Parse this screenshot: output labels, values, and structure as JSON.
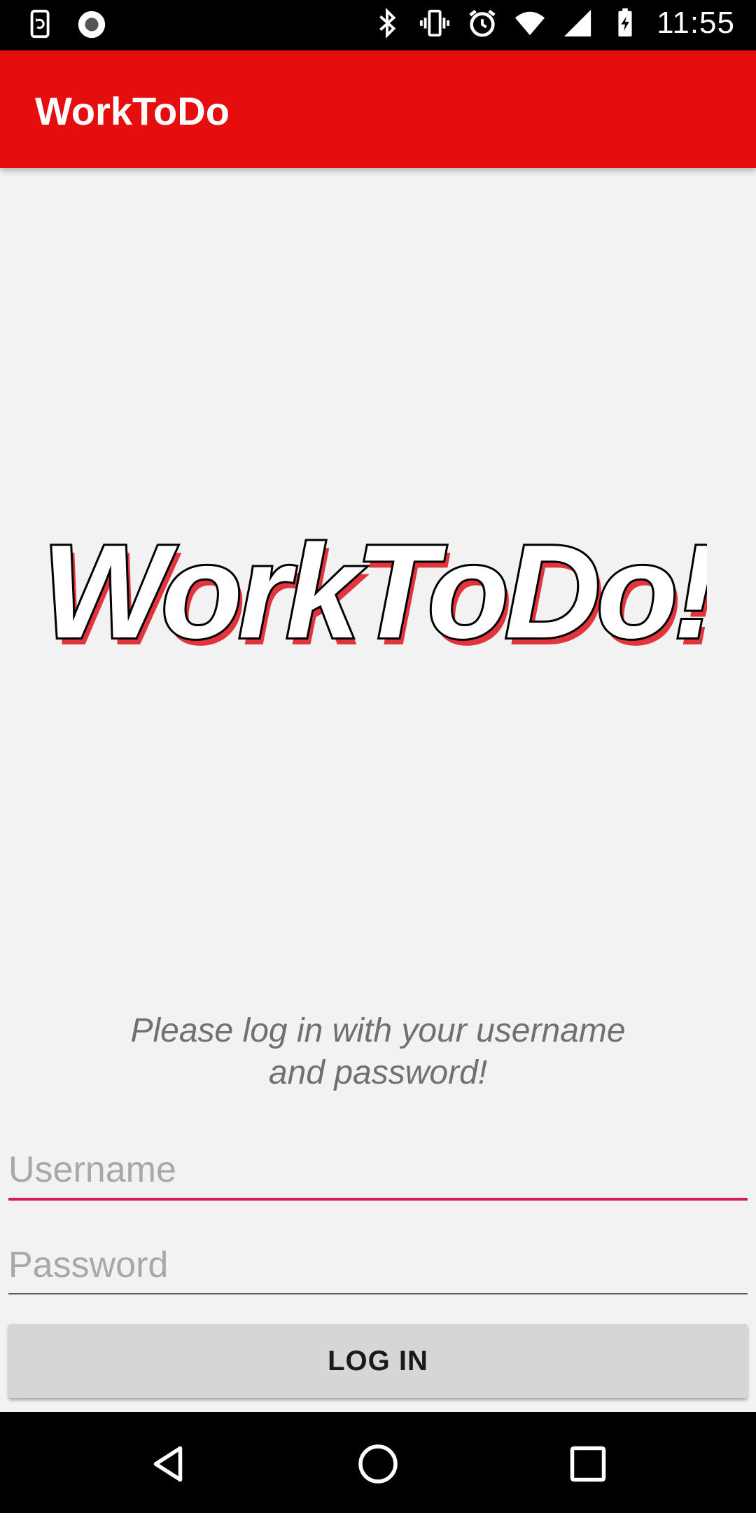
{
  "status_bar": {
    "time": "11:55",
    "left_icons": [
      "screen-rotation-icon",
      "record-icon"
    ],
    "right_icons": [
      "bluetooth-icon",
      "vibrate-icon",
      "alarm-icon",
      "wifi-icon",
      "signal-icon",
      "battery-charging-icon"
    ]
  },
  "app_bar": {
    "title": "WorkToDo",
    "color": "#e50d0d"
  },
  "logo": {
    "text": "WorkToDo!"
  },
  "login": {
    "instruction_line1": "Please log in with your username",
    "instruction_line2": "and password!",
    "username_placeholder": "Username",
    "username_value": "",
    "password_placeholder": "Password",
    "password_value": "",
    "button_label": "LOG IN",
    "focus_color": "#d81b60"
  },
  "nav_bar": {
    "buttons": [
      "back-icon",
      "home-icon",
      "recents-icon"
    ]
  }
}
